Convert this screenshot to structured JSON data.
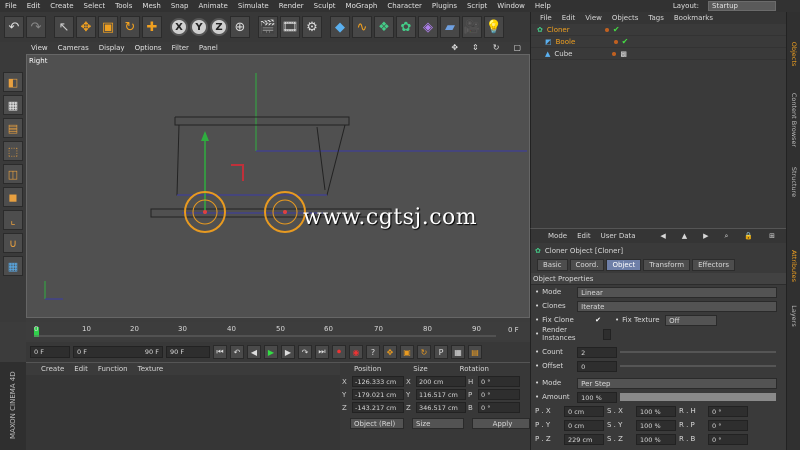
{
  "menubar": {
    "items": [
      "File",
      "Edit",
      "Create",
      "Select",
      "Tools",
      "Mesh",
      "Snap",
      "Animate",
      "Simulate",
      "Render",
      "Sculpt",
      "MoGraph",
      "Character",
      "Plugins",
      "Script",
      "Window",
      "Help"
    ],
    "layout_label": "Layout:",
    "layout_value": "Startup"
  },
  "viewport": {
    "menu": [
      "View",
      "Cameras",
      "Display",
      "Options",
      "Filter",
      "Panel"
    ],
    "label": "Right",
    "watermark": "www.cgtsj.com"
  },
  "timeline": {
    "ticks": [
      "0",
      "10",
      "20",
      "30",
      "40",
      "50",
      "60",
      "70",
      "80",
      "90"
    ],
    "end_label": "0 F"
  },
  "transport": {
    "current": "0 F",
    "min": "0 F",
    "max": "90 F",
    "end": "90 F"
  },
  "material_manager": {
    "menu": [
      "Create",
      "Edit",
      "Function",
      "Texture"
    ],
    "brand": "MAXON CINEMA 4D"
  },
  "coordinates": {
    "headers": [
      "Position",
      "Size",
      "Rotation"
    ],
    "rows": [
      {
        "p_axis": "X",
        "p": "-126.333 cm",
        "s_axis": "X",
        "s": "200 cm",
        "r_axis": "H",
        "r": "0 °"
      },
      {
        "p_axis": "Y",
        "p": "-179.021 cm",
        "s_axis": "Y",
        "s": "116.517 cm",
        "r_axis": "P",
        "r": "0 °"
      },
      {
        "p_axis": "Z",
        "p": "-143.217 cm",
        "s_axis": "Z",
        "s": "346.517 cm",
        "r_axis": "B",
        "r": "0 °"
      }
    ],
    "mode": "Object (Rel)",
    "size_mode": "Size",
    "apply": "Apply"
  },
  "object_manager": {
    "menu": [
      "File",
      "Edit",
      "View",
      "Objects",
      "Tags",
      "Bookmarks"
    ],
    "objects": [
      "Cloner",
      "Boole",
      "Cube"
    ]
  },
  "side_tabs": [
    "Objects",
    "Content Browser",
    "Structure"
  ],
  "attr_side_tabs": [
    "Attributes",
    "Layers"
  ],
  "attributes": {
    "menu": [
      "Mode",
      "Edit",
      "User Data"
    ],
    "title": "Cloner Object [Cloner]",
    "tabs": [
      "Basic",
      "Coord.",
      "Object",
      "Transform",
      "Effectors"
    ],
    "active_tab": "Object",
    "section": "Object Properties",
    "mode_label": "Mode",
    "mode_value": "Linear",
    "clones_label": "Clones",
    "clones_value": "Iterate",
    "fix_clone_label": "Fix Clone",
    "fix_texture_label": "Fix Texture",
    "fix_texture_value": "Off",
    "render_instances_label": "Render Instances",
    "count_label": "Count",
    "count_value": "2",
    "offset_label": "Offset",
    "offset_value": "0",
    "mode2_label": "Mode",
    "mode2_value": "Per Step",
    "amount_label": "Amount",
    "amount_value": "100 %",
    "grid": [
      {
        "p": "P . X",
        "pv": "0 cm",
        "s": "S . X",
        "sv": "100 %",
        "r": "R . H",
        "rv": "0 °"
      },
      {
        "p": "P . Y",
        "pv": "0 cm",
        "s": "S . Y",
        "sv": "100 %",
        "r": "R . P",
        "rv": "0 °"
      },
      {
        "p": "P . Z",
        "pv": "229 cm",
        "s": "S . Z",
        "sv": "100 %",
        "r": "R . B",
        "rv": "0 °"
      }
    ]
  }
}
